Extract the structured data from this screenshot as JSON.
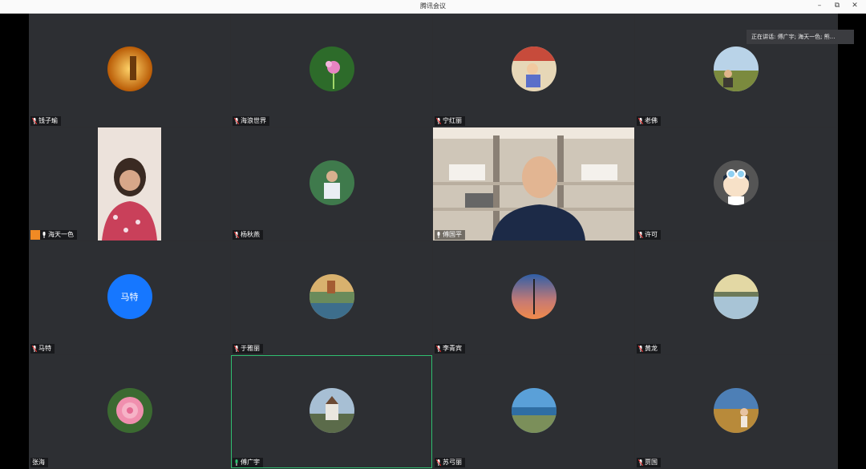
{
  "window": {
    "title": "腾讯会议"
  },
  "speaking": {
    "text": "正在讲话: 傅广宇; 海天一色; 熊..."
  },
  "participants": [
    {
      "name": "钱子瑜"
    },
    {
      "name": "海浪世界"
    },
    {
      "name": "宁红丽"
    },
    {
      "name": "老佛"
    },
    {
      "name": "海天一色"
    },
    {
      "name": "杨秋燕"
    },
    {
      "name": "傅国平"
    },
    {
      "name": "许可"
    },
    {
      "name": "马特",
      "avatar_text": "马特"
    },
    {
      "name": "于雅丽"
    },
    {
      "name": "李青宾"
    },
    {
      "name": "黄龙"
    },
    {
      "name": "张海"
    },
    {
      "name": "傅广宇"
    },
    {
      "name": "苏弓丽"
    },
    {
      "name": "贾国"
    }
  ],
  "colors": {
    "active_border": "#2fbf71",
    "avatar_blue": "#1677ff",
    "tile_bg": "#2d2f33"
  }
}
